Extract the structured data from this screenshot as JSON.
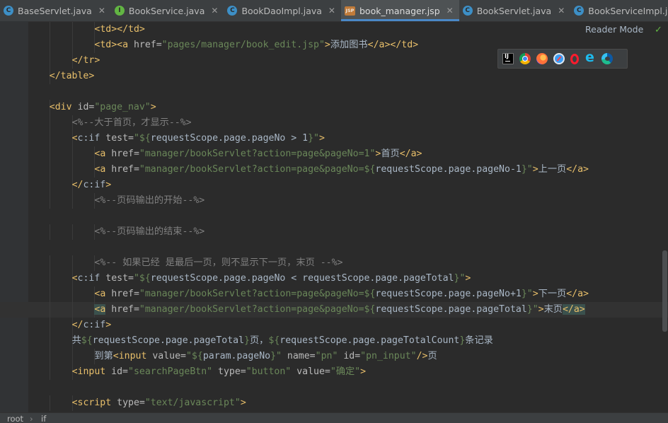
{
  "tabs": [
    {
      "label": "BaseServlet.java",
      "icon": "class-file-icon",
      "icon_letter": "C",
      "active": false
    },
    {
      "label": "BookService.java",
      "icon": "interface-file-icon",
      "icon_letter": "I",
      "active": false
    },
    {
      "label": "BookDaoImpl.java",
      "icon": "class-file-icon",
      "icon_letter": "C",
      "active": false
    },
    {
      "label": "book_manager.jsp",
      "icon": "jsp-file-icon",
      "icon_letter": "JSP",
      "active": true
    },
    {
      "label": "BookServlet.java",
      "icon": "class-file-icon",
      "icon_letter": "C",
      "active": false
    },
    {
      "label": "BookServiceImpl.java",
      "icon": "class-file-icon",
      "icon_letter": "C",
      "active": false
    }
  ],
  "tab_close_glyph": "✕",
  "reader_mode": "Reader Mode",
  "reader_check": "✓",
  "browsers": [
    "intellij-idea-icon",
    "chrome-icon",
    "firefox-icon",
    "safari-icon",
    "opera-icon",
    "internet-explorer-icon",
    "edge-icon"
  ],
  "colors": {
    "background": "#2b2b2b",
    "tag": "#e8bf6a",
    "attribute": "#bababa",
    "string": "#6a8759",
    "comment": "#808080",
    "text": "#a9b7c6",
    "active_tab_underline": "#4a88c7"
  },
  "code_lines": [
    {
      "indent": 4,
      "tokens": [
        [
          "t",
          "<td></td>"
        ]
      ]
    },
    {
      "indent": 4,
      "tokens": [
        [
          "t",
          "<td><a "
        ],
        [
          "a",
          "href="
        ],
        [
          "s",
          "\"pages/manager/book_edit.jsp\""
        ],
        [
          "t",
          ">"
        ],
        [
          "x",
          "添加图书"
        ],
        [
          "t",
          "</a></td>"
        ]
      ]
    },
    {
      "indent": 3,
      "tokens": [
        [
          "t",
          "</tr>"
        ]
      ]
    },
    {
      "indent": 2,
      "tokens": [
        [
          "t",
          "</table>"
        ]
      ]
    },
    {
      "indent": 0,
      "tokens": []
    },
    {
      "indent": 2,
      "tokens": [
        [
          "t",
          "<div "
        ],
        [
          "a",
          "id="
        ],
        [
          "s",
          "\"page_nav\""
        ],
        [
          "t",
          ">"
        ]
      ]
    },
    {
      "indent": 3,
      "tokens": [
        [
          "c",
          "<%--大于首页，才显示--%>"
        ]
      ]
    },
    {
      "indent": 3,
      "tokens": [
        [
          "t",
          "<"
        ],
        [
          "e",
          "c:if "
        ],
        [
          "a",
          "test="
        ],
        [
          "s",
          "\"${"
        ],
        [
          "x",
          "requestScope.page.pageNo > 1"
        ],
        [
          "s",
          "}\""
        ],
        [
          "t",
          ">"
        ]
      ]
    },
    {
      "indent": 4,
      "tokens": [
        [
          "t",
          "<a "
        ],
        [
          "a",
          "href="
        ],
        [
          "s",
          "\"manager/bookServlet?action=page&pageNo=1\""
        ],
        [
          "t",
          ">"
        ],
        [
          "x",
          "首页"
        ],
        [
          "t",
          "</a>"
        ]
      ]
    },
    {
      "indent": 4,
      "tokens": [
        [
          "t",
          "<a "
        ],
        [
          "a",
          "href="
        ],
        [
          "s",
          "\"manager/bookServlet?action=page&pageNo=${"
        ],
        [
          "x",
          "requestScope.page.pageNo-1"
        ],
        [
          "s",
          "}\""
        ],
        [
          "t",
          ">"
        ],
        [
          "x",
          "上一页"
        ],
        [
          "t",
          "</a>"
        ]
      ]
    },
    {
      "indent": 3,
      "tokens": [
        [
          "t",
          "</"
        ],
        [
          "e",
          "c:if"
        ],
        [
          "t",
          ">"
        ]
      ]
    },
    {
      "indent": 4,
      "tokens": [
        [
          "c",
          "<%--页码输出的开始--%>"
        ]
      ]
    },
    {
      "indent": 0,
      "tokens": []
    },
    {
      "indent": 4,
      "tokens": [
        [
          "c",
          "<%--页码输出的结束--%>"
        ]
      ]
    },
    {
      "indent": 0,
      "tokens": []
    },
    {
      "indent": 4,
      "tokens": [
        [
          "c",
          "<%-- 如果已经 是最后一页，则不显示下一页，末页 --%>"
        ]
      ]
    },
    {
      "indent": 3,
      "tokens": [
        [
          "t",
          "<"
        ],
        [
          "e",
          "c:if "
        ],
        [
          "a",
          "test="
        ],
        [
          "s",
          "\"${"
        ],
        [
          "x",
          "requestScope.page.pageNo < requestScope.page.pageTotal"
        ],
        [
          "s",
          "}\""
        ],
        [
          "t",
          ">"
        ]
      ]
    },
    {
      "indent": 4,
      "tokens": [
        [
          "t",
          "<a "
        ],
        [
          "a",
          "href="
        ],
        [
          "s",
          "\"manager/bookServlet?action=page&pageNo=${"
        ],
        [
          "x",
          "requestScope.page.pageNo+1"
        ],
        [
          "s",
          "}\""
        ],
        [
          "t",
          ">"
        ],
        [
          "x",
          "下一页"
        ],
        [
          "t",
          "</a>"
        ]
      ]
    },
    {
      "indent": 4,
      "current": true,
      "tokens": [
        [
          "h",
          "<a"
        ],
        [
          "a",
          " href="
        ],
        [
          "s",
          "\"manager/bookServlet?action=page&pageNo=${"
        ],
        [
          "x",
          "requestScope.page.pageTotal"
        ],
        [
          "s",
          "}\""
        ],
        [
          "t",
          ">"
        ],
        [
          "x",
          "末页"
        ],
        [
          "h",
          "</a>"
        ]
      ]
    },
    {
      "indent": 3,
      "tokens": [
        [
          "t",
          "</"
        ],
        [
          "e",
          "c:if"
        ],
        [
          "t",
          ">"
        ]
      ]
    },
    {
      "indent": 3,
      "tokens": [
        [
          "x",
          "共"
        ],
        [
          "s",
          "${"
        ],
        [
          "x",
          "requestScope.page.pageTotal"
        ],
        [
          "s",
          "}"
        ],
        [
          "x",
          "页，"
        ],
        [
          "s",
          "${"
        ],
        [
          "x",
          "requestScope.page.pageTotalCount"
        ],
        [
          "s",
          "}"
        ],
        [
          "x",
          "条记录"
        ]
      ]
    },
    {
      "indent": 4,
      "tokens": [
        [
          "x",
          "到第"
        ],
        [
          "t",
          "<input "
        ],
        [
          "a",
          "value="
        ],
        [
          "s",
          "\"${"
        ],
        [
          "x",
          "param.pageNo"
        ],
        [
          "s",
          "}\""
        ],
        [
          "a",
          " name="
        ],
        [
          "s",
          "\"pn\""
        ],
        [
          "a",
          " id="
        ],
        [
          "s",
          "\"pn_input\""
        ],
        [
          "t",
          "/>"
        ],
        [
          "x",
          "页"
        ]
      ]
    },
    {
      "indent": 3,
      "tokens": [
        [
          "t",
          "<input "
        ],
        [
          "a",
          "id="
        ],
        [
          "s",
          "\"searchPageBtn\""
        ],
        [
          "a",
          " type="
        ],
        [
          "s",
          "\"button\""
        ],
        [
          "a",
          " value="
        ],
        [
          "s",
          "\"确定\""
        ],
        [
          "t",
          ">"
        ]
      ]
    },
    {
      "indent": 0,
      "tokens": []
    },
    {
      "indent": 3,
      "tokens": [
        [
          "t",
          "<script "
        ],
        [
          "a",
          "type="
        ],
        [
          "s",
          "\"text/javascript\""
        ],
        [
          "t",
          ">"
        ]
      ]
    }
  ],
  "breadcrumb": [
    "root",
    "if"
  ],
  "breadcrumb_sep": "›"
}
